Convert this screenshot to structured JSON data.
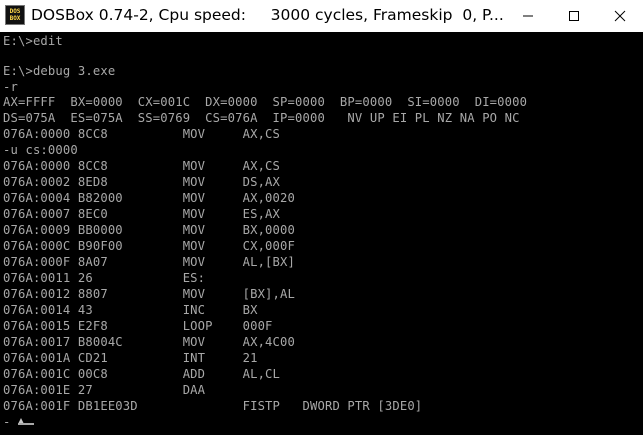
{
  "window": {
    "title": "DOSBox 0.74-2, Cpu speed:     3000 cycles, Frameskip  0, P...",
    "icon_name": "dosbox-icon",
    "icon_text_top": "DOS",
    "icon_text_bottom": "BOX",
    "controls": [
      "minimize-icon",
      "maximize-icon",
      "close-icon"
    ]
  },
  "console": {
    "lines": [
      "E:\\>edit",
      "",
      "E:\\>debug 3.exe",
      "-r",
      "AX=FFFF  BX=0000  CX=001C  DX=0000  SP=0000  BP=0000  SI=0000  DI=0000",
      "DS=075A  ES=075A  SS=0769  CS=076A  IP=0000   NV UP EI PL NZ NA PO NC",
      "076A:0000 8CC8          MOV     AX,CS",
      "-u cs:0000",
      "076A:0000 8CC8          MOV     AX,CS",
      "076A:0002 8ED8          MOV     DS,AX",
      "076A:0004 B82000        MOV     AX,0020",
      "076A:0007 8EC0          MOV     ES,AX",
      "076A:0009 BB0000        MOV     BX,0000",
      "076A:000C B90F00        MOV     CX,000F",
      "076A:000F 8A07          MOV     AL,[BX]",
      "076A:0011 26            ES:",
      "076A:0012 8807          MOV     [BX],AL",
      "076A:0014 43            INC     BX",
      "076A:0015 E2F8          LOOP    000F",
      "076A:0017 B8004C        MOV     AX,4C00",
      "076A:001A CD21          INT     21",
      "076A:001C 00C8          ADD     AL,CL",
      "076A:001E 27            DAA",
      "076A:001F DB1EE03D              FISTP   DWORD PTR [3DE0]",
      "-"
    ]
  }
}
